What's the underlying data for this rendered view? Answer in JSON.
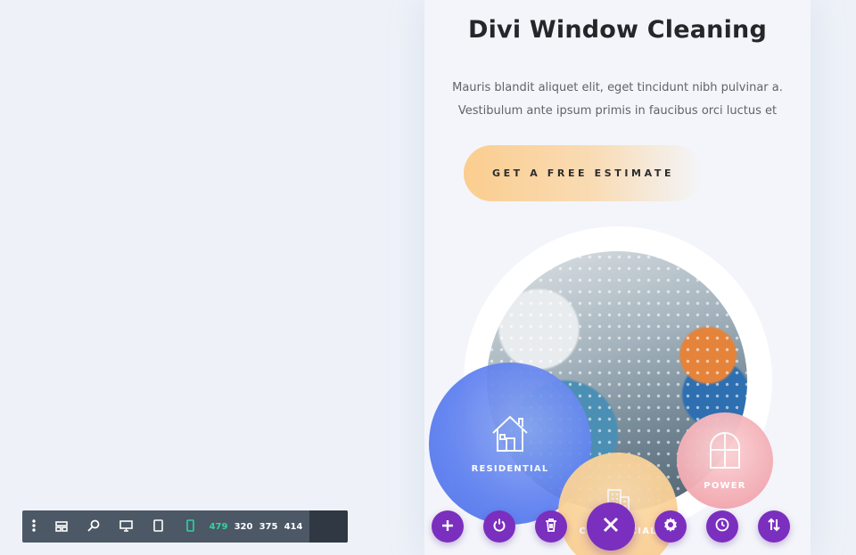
{
  "hero": {
    "title": "Divi Window Cleaning",
    "body_line1": "Mauris blandit aliquet elit, eget tincidunt nibh pulvinar a.",
    "body_line2": "Vestibulum ante ipsum primis in faucibus orci luctus et",
    "cta_label": "GET A FREE ESTIMATE"
  },
  "services": [
    {
      "label": "RESIDENTIAL",
      "icon": "house-icon",
      "color": "#5b7df0"
    },
    {
      "label": "COMMERCIAL",
      "icon": "building-icon",
      "color": "#f9c985"
    },
    {
      "label": "POWER",
      "icon": "arched-window-icon",
      "color": "#ef9aa3"
    }
  ],
  "builder_actions": [
    {
      "name": "add",
      "icon": "plus-icon"
    },
    {
      "name": "power",
      "icon": "power-icon"
    },
    {
      "name": "delete",
      "icon": "trash-icon"
    },
    {
      "name": "close",
      "icon": "close-icon"
    },
    {
      "name": "settings",
      "icon": "gear-icon"
    },
    {
      "name": "history",
      "icon": "clock-icon"
    },
    {
      "name": "sort",
      "icon": "sort-arrows-icon"
    }
  ],
  "toolbar": {
    "icons": [
      "dots-vertical-icon",
      "layout-icon",
      "zoom-icon",
      "desktop-icon",
      "tablet-icon",
      "phone-icon"
    ],
    "widths": {
      "active": "479",
      "w320": "320",
      "w375": "375",
      "w414": "414"
    }
  },
  "colors": {
    "accent_purple": "#7b2fbe",
    "active_width": "#2fd3a1",
    "toolbar_bg": "#4c5866",
    "cta_orange": "#fbcd8f"
  }
}
